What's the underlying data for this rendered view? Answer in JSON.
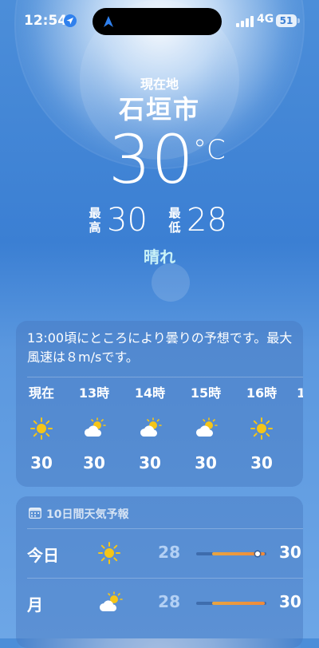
{
  "status_bar": {
    "time": "12:54",
    "network": "4G",
    "battery": "51"
  },
  "current": {
    "location_label": "現在地",
    "city": "石垣市",
    "temperature": "30",
    "unit": "°C",
    "high_label": "最高",
    "high": "30",
    "low_label": "最低",
    "low": "28",
    "condition": "晴れ"
  },
  "hourly": {
    "summary": "13:00頃にところにより曇りの予想です。最大風速は８m/sです。",
    "items": [
      {
        "label": "現在",
        "icon": "sun-icon",
        "temp": "30"
      },
      {
        "label": "13時",
        "icon": "partly-cloudy-icon",
        "temp": "30"
      },
      {
        "label": "14時",
        "icon": "partly-cloudy-icon",
        "temp": "30"
      },
      {
        "label": "15時",
        "icon": "partly-cloudy-icon",
        "temp": "30"
      },
      {
        "label": "16時",
        "icon": "sun-icon",
        "temp": "30"
      },
      {
        "label": "1",
        "icon": "",
        "temp": ""
      }
    ]
  },
  "daily": {
    "title": "10日間天気予報",
    "days": [
      {
        "name": "今日",
        "icon": "sun-icon",
        "low": "28",
        "high": "30",
        "current_marker": 0.88
      },
      {
        "name": "月",
        "icon": "partly-cloudy-icon",
        "low": "28",
        "high": "30"
      }
    ]
  },
  "colors": {
    "sky": "#3b7fd3",
    "sun": "#f5c518",
    "range_bar": "#f08a3a",
    "condition_text": "#c9f2f7"
  }
}
